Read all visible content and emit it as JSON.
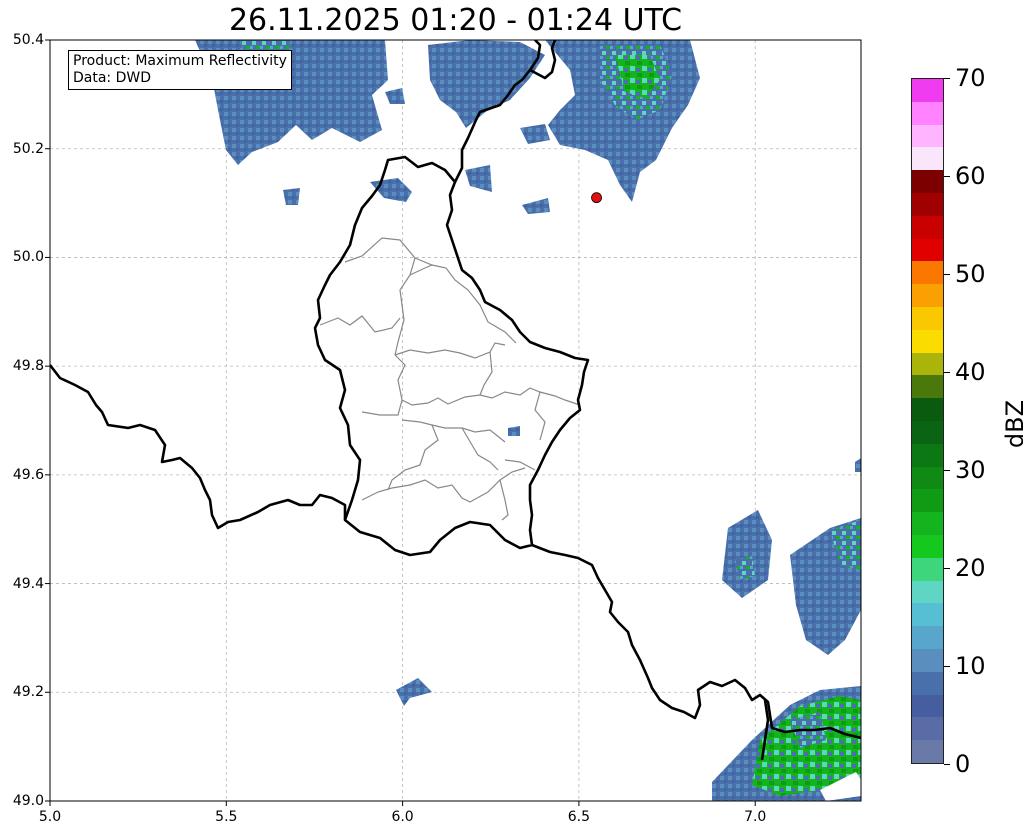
{
  "title": "26.11.2025 01:20 - 01:24 UTC",
  "info": {
    "product_line": "Product: Maximum Reflectivity",
    "data_line": "Data: DWD"
  },
  "map": {
    "lon_range": [
      5.0,
      7.3
    ],
    "lat_range": [
      49.0,
      50.4
    ],
    "x_ticks": [
      "5.0",
      "5.5",
      "6.0",
      "6.5",
      "7.0"
    ],
    "y_ticks": [
      "49.0",
      "49.2",
      "49.4",
      "49.6",
      "49.8",
      "50.0",
      "50.2",
      "50.4"
    ],
    "grid": true,
    "marker": {
      "lon": 6.55,
      "lat": 50.11,
      "color": "#e01010"
    }
  },
  "colorbar": {
    "label": "dBZ",
    "tick_labels": [
      "0",
      "10",
      "20",
      "30",
      "40",
      "50",
      "60",
      "70"
    ],
    "range": [
      0,
      70
    ],
    "colors": [
      "#6a7aa8",
      "#5a6ca5",
      "#465ea0",
      "#4a70ac",
      "#5a8ebe",
      "#59a6cc",
      "#56bfd4",
      "#5fd6c4",
      "#3ed67c",
      "#14c81e",
      "#14b41e",
      "#0f9c14",
      "#0f8a14",
      "#0c7814",
      "#0a6414",
      "#0a5a0f",
      "#4b780a",
      "#aab40a",
      "#fadc00",
      "#fac800",
      "#faa000",
      "#fa7800",
      "#e10000",
      "#c80000",
      "#a00000",
      "#7c0000",
      "#fae6fa",
      "#ffb4ff",
      "#ff82ff",
      "#f03cf0"
    ]
  },
  "precip_colors": {
    "low": "#4a70ac",
    "mid": "#59a6cc",
    "teal": "#5fd6c4",
    "green": "#14b41e",
    "dark": "#0f9c14"
  }
}
